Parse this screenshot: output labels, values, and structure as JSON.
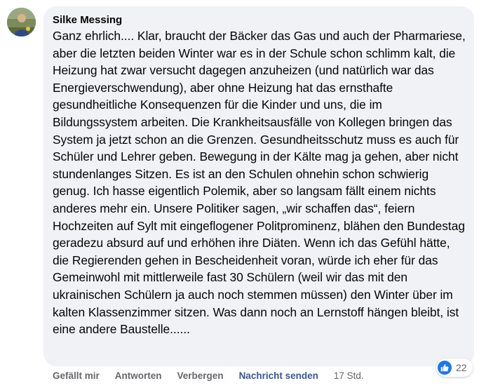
{
  "comment": {
    "author": "Silke Messing",
    "text": "Ganz ehrlich.... Klar, braucht der Bäcker das Gas und auch der Pharmariese, aber die letzten beiden Winter war es in der Schule schon schlimm kalt, die Heizung hat zwar versucht dagegen anzuheizen (und natürlich war das Energieverschwendung), aber ohne Heizung hat das ernsthafte gesundheitliche Konsequenzen für die Kinder und uns, die im Bildungssystem arbeiten. Die Krankheitsausfälle von Kollegen bringen das System ja jetzt schon an die Grenzen. Gesundheitsschutz muss es auch für Schüler und Lehrer geben. Bewegung in der Kälte mag ja gehen, aber nicht stundenlanges Sitzen. Es ist an den Schulen ohnehin schon schwierig genug. Ich hasse eigentlich Polemik, aber so langsam fällt einem nichts anderes mehr ein. Unsere Politiker sagen, „wir schaffen das“, feiern Hochzeiten auf Sylt mit eingeflogener Politprominenz, blähen den Bundestag geradezu absurd auf und erhöhen ihre Diäten. Wenn ich das Gefühl hätte, die Regierenden gehen in Bescheidenheit voran, würde ich eher für das Gemeinwohl mit mittlerweile fast 30 Schülern (weil wir das mit den ukrainischen Schülern ja auch noch stemmen müssen) den Winter über im kalten Klassenzimmer sitzen. Was dann noch an Lernstoff hängen bleibt, ist eine andere Baustelle......"
  },
  "actions": {
    "like": "Gefällt mir",
    "reply": "Antworten",
    "hide": "Verbergen",
    "send_message": "Nachricht senden",
    "time": "17 Std."
  },
  "reactions": {
    "icon": "like-thumbs-up-icon",
    "count": "22"
  },
  "colors": {
    "bubble": "#f0f2f5",
    "meta_text": "#65676b",
    "send_message_link": "#385898",
    "like_blue": "#1877f2"
  }
}
